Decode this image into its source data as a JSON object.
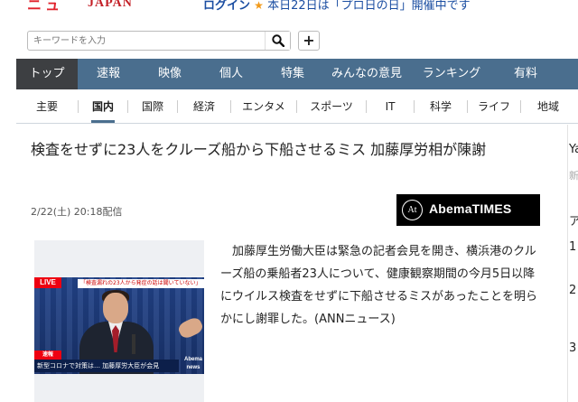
{
  "header": {
    "logo_text": "ニュ",
    "logo_sub": "JAPAN",
    "promo_login": "ログイン",
    "promo_text": "本日22日は「プロ日の日」開催中です"
  },
  "search": {
    "placeholder": "キーワードを入力",
    "plus_label": "+"
  },
  "nav_primary": {
    "items": [
      "トップ",
      "速報",
      "映像",
      "個人",
      "特集",
      "みんなの意見",
      "ランキング",
      "有料"
    ],
    "active": "トップ"
  },
  "nav_secondary": {
    "items": [
      "主要",
      "国内",
      "国際",
      "経済",
      "エンタメ",
      "スポーツ",
      "IT",
      "科学",
      "ライフ",
      "地域"
    ],
    "active": "国内"
  },
  "article": {
    "title": "検査をせずに23人をクルーズ船から下船させるミス 加藤厚労相が陳謝",
    "date": "2/22(土) 20:18配信",
    "source_logo": "AbemaTIMES",
    "body": "加藤厚生労働大臣は緊急の記者会見を開き、横浜港のクルーズ船の乗船者23人について、健康観察期間の今月5日以降にウイルス検査をせずに下船させるミスがあったことを明らかにし謝罪した。(ANNニュース)"
  },
  "photo": {
    "live_label": "LIVE",
    "top_caption": "「検査漏れの23人から発症の話は聞いていない」",
    "badge": "速報",
    "caption": "新型コロナで対策は… 加藤厚労大臣が会見",
    "watermark": "Abema news"
  },
  "right_column": {
    "fragments": [
      "Ya",
      "新",
      "ア",
      "1",
      "2",
      "3"
    ]
  },
  "colors": {
    "nav_primary_bg": "#4a6e8e",
    "nav_active_bg": "#3d3f42",
    "abema_bg": "#000000"
  }
}
